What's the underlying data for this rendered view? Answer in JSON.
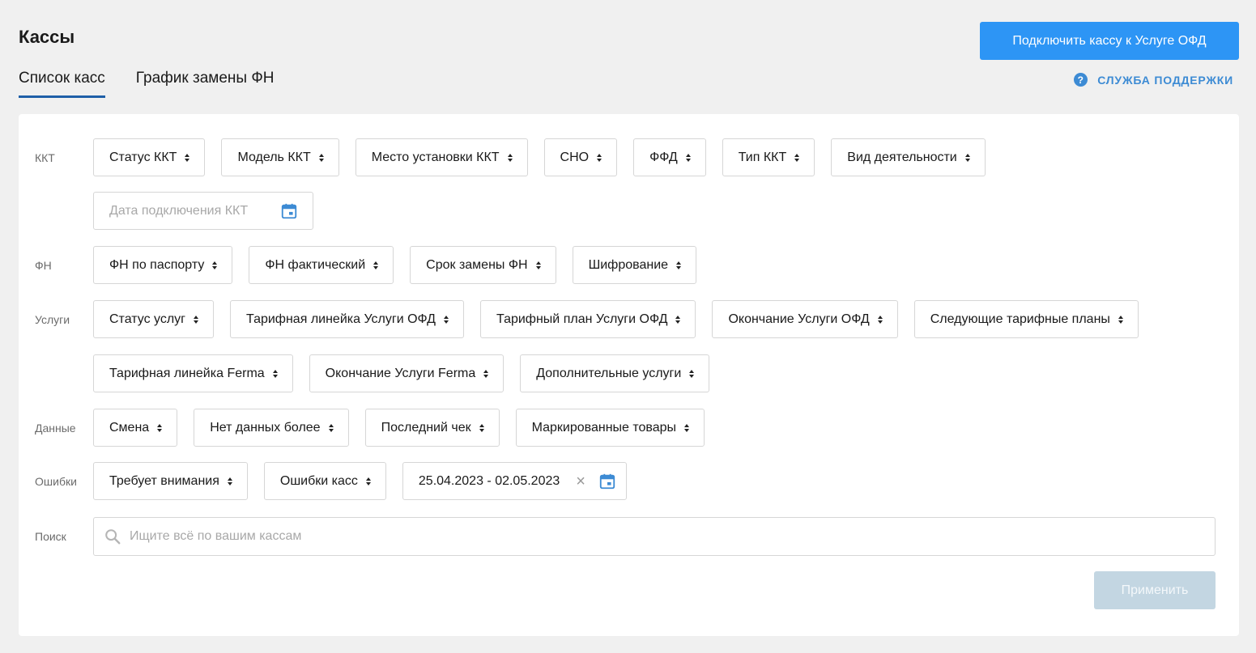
{
  "header": {
    "title": "Кассы",
    "connect_button": "Подключить кассу к Услуге ОФД"
  },
  "tabs": [
    {
      "label": "Список касс",
      "active": true
    },
    {
      "label": "График замены ФН",
      "active": false
    }
  ],
  "support": {
    "label": "СЛУЖБА ПОДДЕРЖКИ",
    "icon": "help-circle-icon"
  },
  "filters": {
    "kkt": {
      "label": "ККТ",
      "chips": [
        "Статус ККТ",
        "Модель ККТ",
        "Место установки ККТ",
        "СНО",
        "ФФД",
        "Тип ККТ",
        "Вид деятельности"
      ],
      "date_placeholder": "Дата подключения ККТ"
    },
    "fn": {
      "label": "ФН",
      "chips": [
        "ФН по паспорту",
        "ФН фактический",
        "Срок замены ФН",
        "Шифрование"
      ]
    },
    "services": {
      "label": "Услуги",
      "chips_row1": [
        "Статус услуг",
        "Тарифная линейка Услуги ОФД",
        "Тарифный план Услуги ОФД",
        "Окончание Услуги ОФД",
        "Следующие тарифные планы"
      ],
      "chips_row2": [
        "Тарифная линейка Ferma",
        "Окончание Услуги Ferma",
        "Дополнительные услуги"
      ]
    },
    "data": {
      "label": "Данные",
      "chips": [
        "Смена",
        "Нет данных более",
        "Последний чек",
        "Маркированные товары"
      ]
    },
    "errors": {
      "label": "Ошибки",
      "chips": [
        "Требует внимания",
        "Ошибки касс"
      ],
      "date_range_value": "25.04.2023 - 02.05.2023"
    },
    "search": {
      "label": "Поиск",
      "placeholder": "Ищите всё по вашим кассам",
      "value": ""
    }
  },
  "apply_button": "Применить",
  "colors": {
    "accent": "#2d95f5",
    "tab_underline": "#1e5fa8",
    "calendar_icon": "#3d8bd4",
    "apply_disabled": "#c3d6e2"
  }
}
